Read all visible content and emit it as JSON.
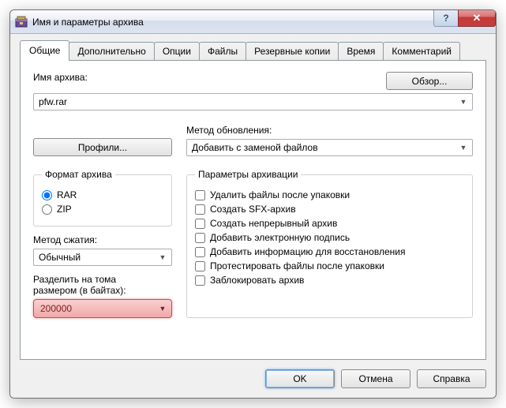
{
  "title": "Имя и параметры архива",
  "tabs": [
    "Общие",
    "Дополнительно",
    "Опции",
    "Файлы",
    "Резервные копии",
    "Время",
    "Комментарий"
  ],
  "archive_name_label": "Имя архива:",
  "browse_label": "Обзор...",
  "archive_name_value": "pfw.rar",
  "profiles_label": "Профили...",
  "update_method_label": "Метод обновления:",
  "update_method_value": "Добавить с заменой файлов",
  "format_legend": "Формат архива",
  "format_options": {
    "rar": "RAR",
    "zip": "ZIP"
  },
  "compression_label": "Метод сжатия:",
  "compression_value": "Обычный",
  "split_label_line1": "Разделить на тома",
  "split_label_line2": "размером (в байтах):",
  "split_value": "200000",
  "params_legend": "Параметры архивации",
  "params": [
    "Удалить файлы после упаковки",
    "Создать SFX-архив",
    "Создать непрерывный архив",
    "Добавить электронную подпись",
    "Добавить информацию для восстановления",
    "Протестировать файлы после упаковки",
    "Заблокировать архив"
  ],
  "footer": {
    "ok": "OK",
    "cancel": "Отмена",
    "help": "Справка"
  }
}
